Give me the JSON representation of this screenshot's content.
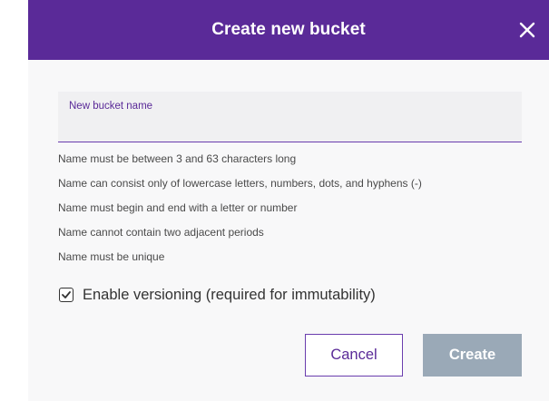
{
  "dialog": {
    "title": "Create new bucket",
    "close_icon": "close-icon",
    "bucket_name_field": {
      "label": "New bucket name",
      "value": "",
      "placeholder": ""
    },
    "name_rules": [
      "Name must be between 3 and 63 characters long",
      "Name can consist only of lowercase letters, numbers, dots, and hyphens (-)",
      "Name must begin and end with a letter or number",
      "Name cannot contain two adjacent periods",
      "Name must be unique"
    ],
    "versioning_checkbox": {
      "label": "Enable versioning (required for immutability)",
      "checked": true
    },
    "buttons": {
      "cancel_label": "Cancel",
      "create_label": "Create",
      "create_disabled": true
    }
  },
  "colors": {
    "header_bg": "#5a2a98",
    "accent": "#6a3dae",
    "create_disabled_bg": "#9aa9b7",
    "dialog_bg": "#f8f8f9"
  }
}
